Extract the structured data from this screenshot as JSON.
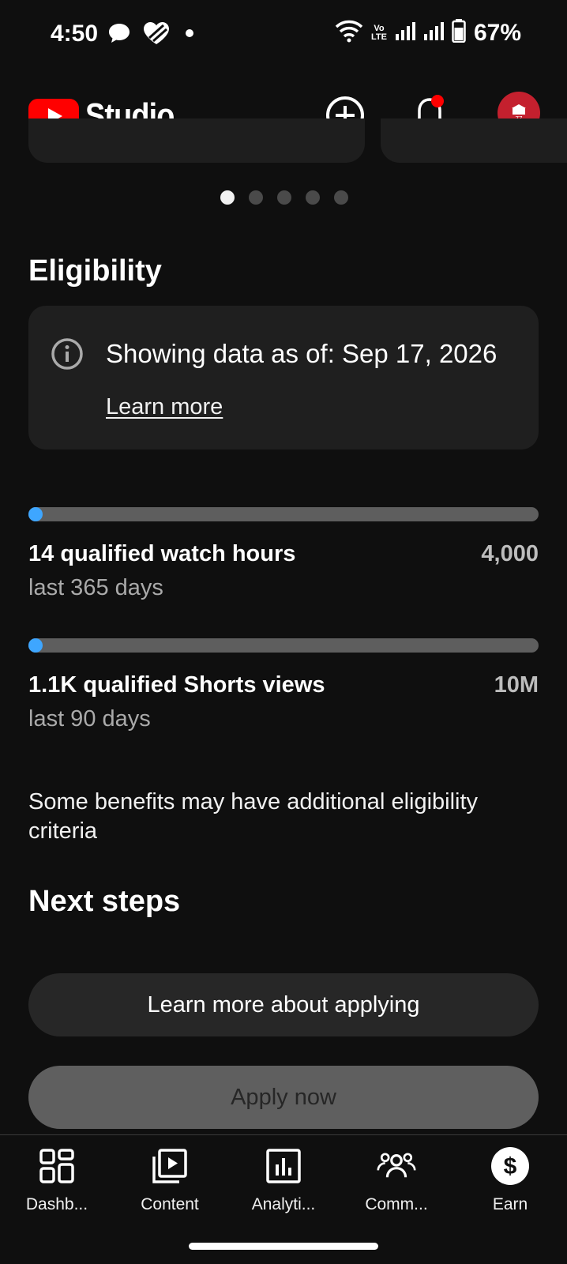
{
  "status_bar": {
    "time": "4:50",
    "battery": "67%",
    "network_label_top": "Vo",
    "network_label_bottom": "LTE"
  },
  "header": {
    "app_name": "Studio",
    "avatar_text": "77",
    "brand_color": "#ff0000",
    "notification_dot_color": "#ff0000"
  },
  "carousel": {
    "page_count": 5,
    "active_index": 0
  },
  "eligibility": {
    "title": "Eligibility",
    "info_text": "Showing data as of: Sep 17, 2026",
    "info_link": "Learn more",
    "metrics": [
      {
        "label": "14 qualified watch hours",
        "period": "last 365 days",
        "goal": "4,000",
        "progress_fraction": 0.0035
      },
      {
        "label": "1.1K qualified Shorts views",
        "period": "last 90 days",
        "goal": "10M",
        "progress_fraction": 0.0001
      }
    ],
    "note": "Some benefits may have additional eligibility criteria",
    "progress_color": "#3ea6ff"
  },
  "next_steps": {
    "title": "Next steps",
    "learn_button": "Learn more about applying",
    "apply_button": "Apply now"
  },
  "bottom_nav": {
    "items": [
      {
        "label": "Dashb...",
        "icon": "dashboard-icon"
      },
      {
        "label": "Content",
        "icon": "content-icon"
      },
      {
        "label": "Analyti...",
        "icon": "analytics-icon"
      },
      {
        "label": "Comm...",
        "icon": "community-icon"
      },
      {
        "label": "Earn",
        "icon": "earn-icon"
      }
    ],
    "active": "Earn"
  }
}
